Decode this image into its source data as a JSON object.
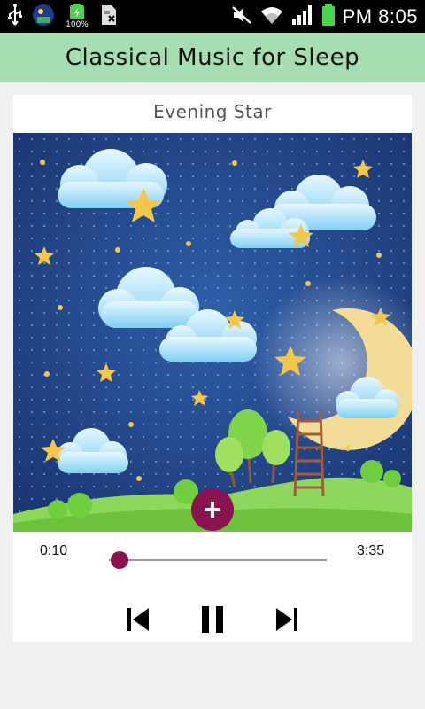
{
  "status_bar": {
    "time": "PM 8:05",
    "battery_percent": "100%",
    "icons": [
      "usb-icon",
      "app-notification-icon",
      "battery-full-icon",
      "sim-alert-icon",
      "mute-icon",
      "wifi-icon",
      "signal-icon",
      "battery-icon"
    ]
  },
  "app": {
    "title": "Classical Music for Sleep",
    "accent": "#a6ddb1"
  },
  "player": {
    "track_title": "Evening Star",
    "elapsed": "0:10",
    "duration": "3:35",
    "progress_fraction": 0.047,
    "add_button_color": "#8a1350",
    "controls": [
      "previous-icon",
      "pause-icon",
      "next-icon"
    ]
  }
}
